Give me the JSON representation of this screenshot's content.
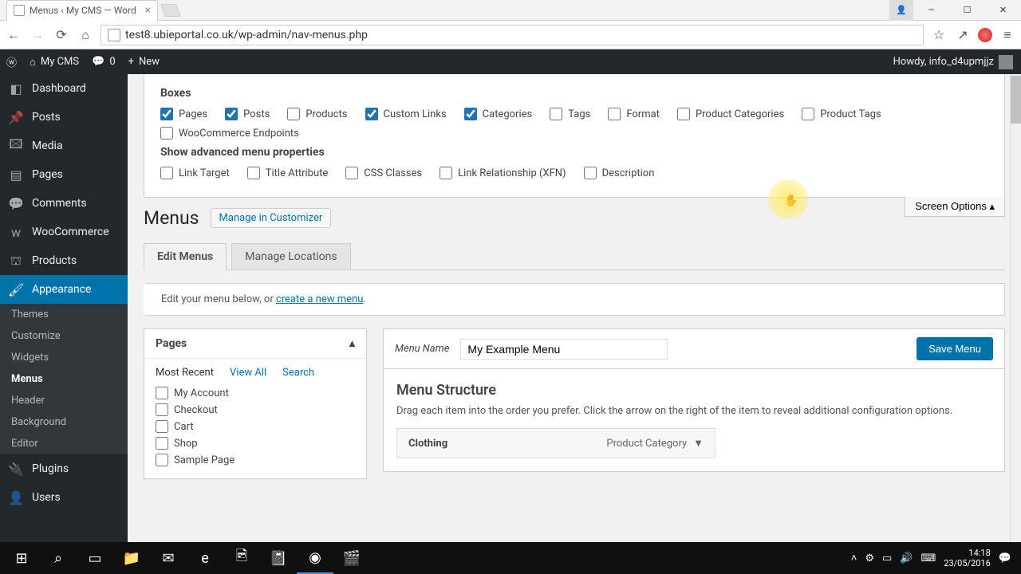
{
  "browser": {
    "tab_title": "Menus ‹ My CMS — Word",
    "url": "test8.ubieportal.co.uk/wp-admin/nav-menus.php"
  },
  "adminbar": {
    "site": "My CMS",
    "comments": "0",
    "new": "New",
    "howdy": "Howdy, info_d4upmjjz"
  },
  "sidebar": {
    "dashboard": "Dashboard",
    "posts": "Posts",
    "media": "Media",
    "pages": "Pages",
    "comments": "Comments",
    "woocommerce": "WooCommerce",
    "products": "Products",
    "appearance": "Appearance",
    "plugins": "Plugins",
    "users": "Users",
    "submenu": {
      "themes": "Themes",
      "customize": "Customize",
      "widgets": "Widgets",
      "menus": "Menus",
      "header": "Header",
      "background": "Background",
      "editor": "Editor"
    }
  },
  "screen_options": {
    "toggle": "Screen Options",
    "boxes_h": "Boxes",
    "boxes": {
      "pages": "Pages",
      "posts": "Posts",
      "products": "Products",
      "custom_links": "Custom Links",
      "categories": "Categories",
      "tags": "Tags",
      "format": "Format",
      "product_categories": "Product Categories",
      "product_tags": "Product Tags",
      "woo_endpoints": "WooCommerce Endpoints"
    },
    "advanced_h": "Show advanced menu properties",
    "advanced": {
      "link_target": "Link Target",
      "title_attribute": "Title Attribute",
      "css_classes": "CSS Classes",
      "link_rel": "Link Relationship (XFN)",
      "description": "Description"
    }
  },
  "page": {
    "heading": "Menus",
    "customizer": "Manage in Customizer",
    "tab_edit": "Edit Menus",
    "tab_locations": "Manage Locations",
    "notice_pre": "Edit your menu below, or ",
    "notice_link": "create a new menu",
    "notice_post": "."
  },
  "pages_box": {
    "title": "Pages",
    "tab_recent": "Most Recent",
    "tab_all": "View All",
    "tab_search": "Search",
    "items": [
      "My Account",
      "Checkout",
      "Cart",
      "Shop",
      "Sample Page"
    ]
  },
  "menu": {
    "name_label": "Menu Name",
    "name_value": "My Example Menu",
    "save": "Save Menu",
    "structure_h": "Menu Structure",
    "structure_p": "Drag each item into the order you prefer. Click the arrow on the right of the item to reveal additional configuration options.",
    "item_label": "Clothing",
    "item_type": "Product Category"
  },
  "taskbar": {
    "time": "14:18",
    "date": "23/05/2016"
  }
}
